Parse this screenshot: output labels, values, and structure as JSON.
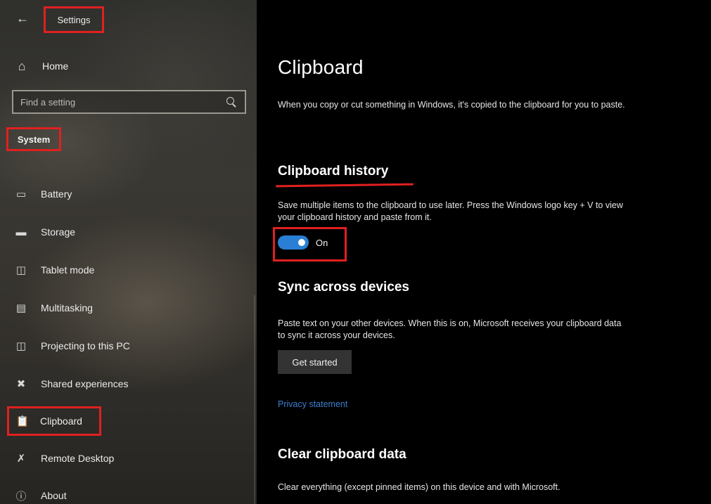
{
  "window": {
    "title": "Settings",
    "back_icon": "back-arrow-icon"
  },
  "sidebar": {
    "home": {
      "label": "Home",
      "icon": "home-icon"
    },
    "search": {
      "placeholder": "Find a setting",
      "icon": "search-icon"
    },
    "section_label": "System",
    "items": [
      {
        "label": "Battery",
        "icon": "battery-icon"
      },
      {
        "label": "Storage",
        "icon": "storage-icon"
      },
      {
        "label": "Tablet mode",
        "icon": "tablet-mode-icon"
      },
      {
        "label": "Multitasking",
        "icon": "multitasking-icon"
      },
      {
        "label": "Projecting to this PC",
        "icon": "projecting-icon"
      },
      {
        "label": "Shared experiences",
        "icon": "shared-experiences-icon"
      },
      {
        "label": "Clipboard",
        "icon": "clipboard-icon",
        "selected": true
      },
      {
        "label": "Remote Desktop",
        "icon": "remote-desktop-icon"
      },
      {
        "label": "About",
        "icon": "about-icon"
      }
    ]
  },
  "main": {
    "title": "Clipboard",
    "intro": "When you copy or cut something in Windows, it's copied to the clipboard for you to paste.",
    "history": {
      "heading": "Clipboard history",
      "description": "Save multiple items to the clipboard to use later. Press the Windows logo key + V to view your clipboard history and paste from it.",
      "toggle_state": "On",
      "toggle_on": true
    },
    "sync": {
      "heading": "Sync across devices",
      "description": "Paste text on your other devices. When this is on, Microsoft receives your clipboard data to sync it across your devices.",
      "button_label": "Get started"
    },
    "privacy_link": "Privacy statement",
    "clear": {
      "heading": "Clear clipboard data",
      "description": "Clear everything (except pinned items) on this device and with Microsoft."
    }
  },
  "colors": {
    "accent": "#2a7fd4",
    "link": "#3a7fd0",
    "annotation_red": "#e02020",
    "main_background": "#000000"
  }
}
